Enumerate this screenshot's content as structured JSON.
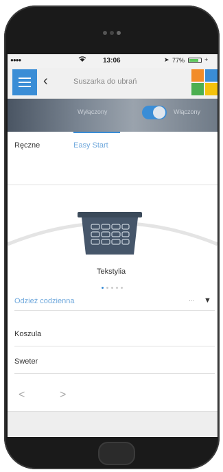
{
  "status_bar": {
    "signal": "●●●●",
    "time": "13:06",
    "battery_percent": "77%",
    "battery_level": 0.77
  },
  "nav": {
    "menu_icon": "hamburger-icon",
    "back_icon": "chevron-left-icon",
    "back_glyph": "‹",
    "title": "Suszarka do ubrań",
    "tile_colors": [
      "#f28c28",
      "#3a8dd6",
      "#4caf50",
      "#f4c20d"
    ]
  },
  "banner": {
    "off_label": "Wyłączony",
    "on_label": "Włączony",
    "toggle_state": "on",
    "accent": "#3a8dd6"
  },
  "tabs": {
    "manual": "Ręczne",
    "easy_start": "Easy Start",
    "active": "easy_start"
  },
  "main": {
    "basket_label": "Tekstylia",
    "pager_dots": 5,
    "active_dot": 0,
    "program_value": "Odzież codzienna",
    "program_more": "...",
    "program_caret": "▼",
    "items": [
      {
        "label": "Koszula"
      },
      {
        "label": "Sweter"
      }
    ],
    "prev_glyph": "<",
    "next_glyph": ">"
  }
}
